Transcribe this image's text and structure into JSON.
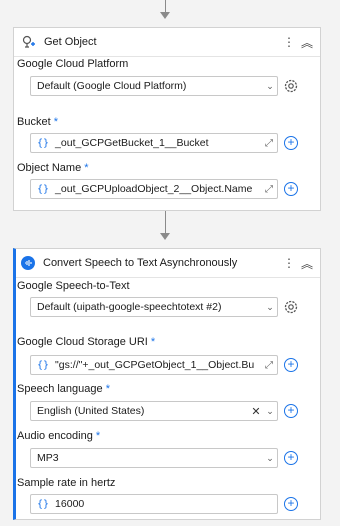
{
  "get_object": {
    "title": "Get Object",
    "fields": {
      "platform_label": "Google Cloud Platform",
      "platform_value": "Default (Google Cloud Platform)",
      "bucket_label": "Bucket",
      "bucket_value": "_out_GCPGetBucket_1__Bucket",
      "object_label": "Object Name",
      "object_value": "_out_GCPUploadObject_2__Object.Name"
    }
  },
  "speech": {
    "title": "Convert Speech to Text Asynchronously",
    "fields": {
      "connection_label": "Google Speech-to-Text",
      "connection_value": "Default (uipath-google-speechtotext #2)",
      "uri_label": "Google Cloud Storage URI",
      "uri_value": "\"gs://\"+_out_GCPGetObject_1__Object.Bu",
      "language_label": "Speech language",
      "language_value": "English (United States)",
      "encoding_label": "Audio encoding",
      "encoding_value": "MP3",
      "rate_label": "Sample rate in hertz",
      "rate_value": "16000"
    }
  },
  "symbols": {
    "required": "*",
    "curly": "{}",
    "more": "⋮",
    "collapse": "︽",
    "chevron": "⌄",
    "expand": "⤢",
    "plus": "+",
    "clear": "✕"
  },
  "colors": {
    "accent": "#1a73e8",
    "border": "#c8c8c8"
  }
}
